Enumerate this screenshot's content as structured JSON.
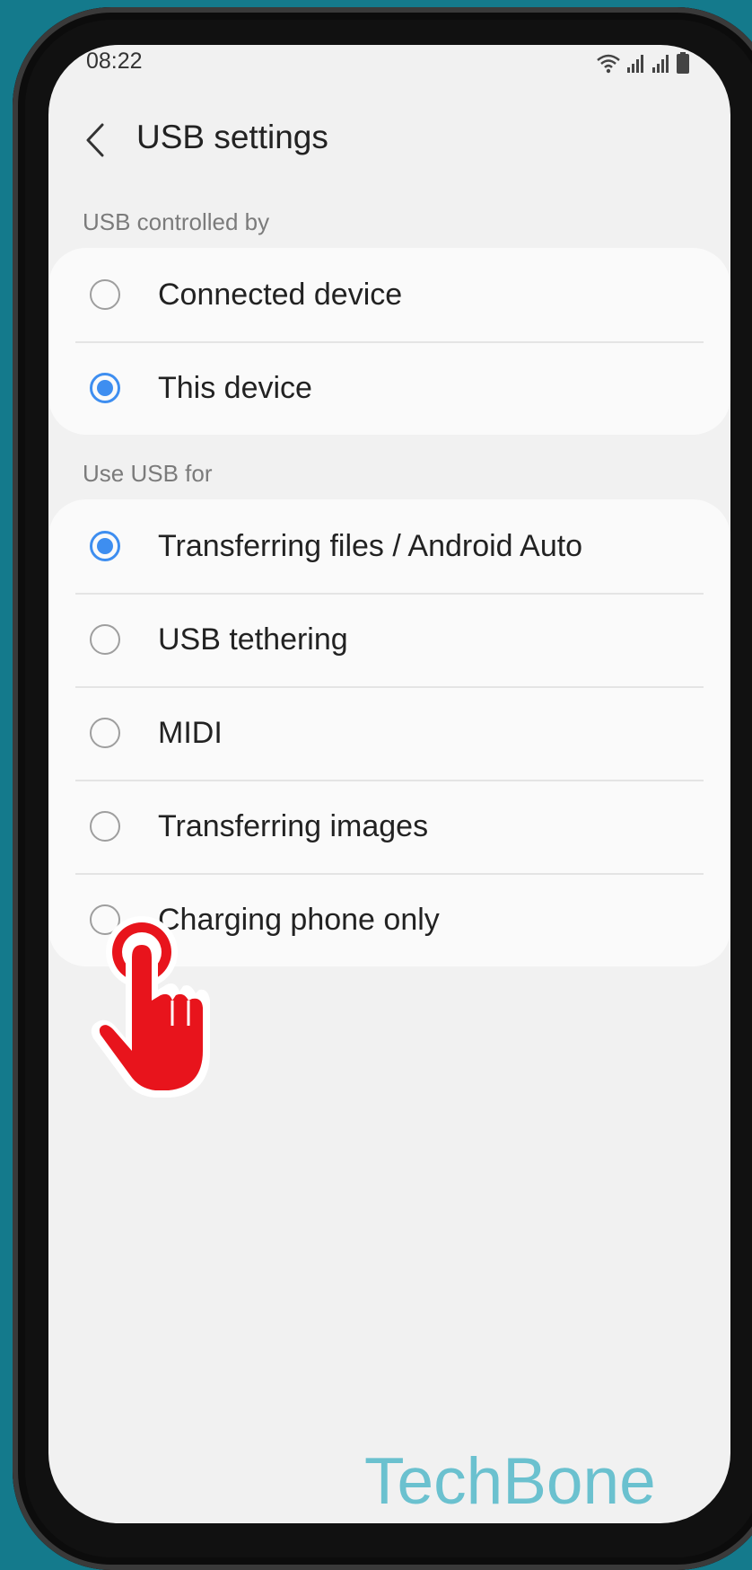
{
  "status_bar": {
    "time": "08:22"
  },
  "header": {
    "title": "USB settings"
  },
  "sections": [
    {
      "label": "USB controlled by",
      "options": [
        {
          "label": "Connected device",
          "checked": false
        },
        {
          "label": "This device",
          "checked": true
        }
      ]
    },
    {
      "label": "Use USB for",
      "options": [
        {
          "label": "Transferring files / Android Auto",
          "checked": true
        },
        {
          "label": "USB tethering",
          "checked": false
        },
        {
          "label": "MIDI",
          "checked": false
        },
        {
          "label": "Transferring images",
          "checked": false
        },
        {
          "label": "Charging phone only",
          "checked": false
        }
      ]
    }
  ],
  "watermark": "TechBone",
  "colors": {
    "accent": "#3e8ef0",
    "pointer": "#e8141c",
    "background": "#147a8c"
  }
}
